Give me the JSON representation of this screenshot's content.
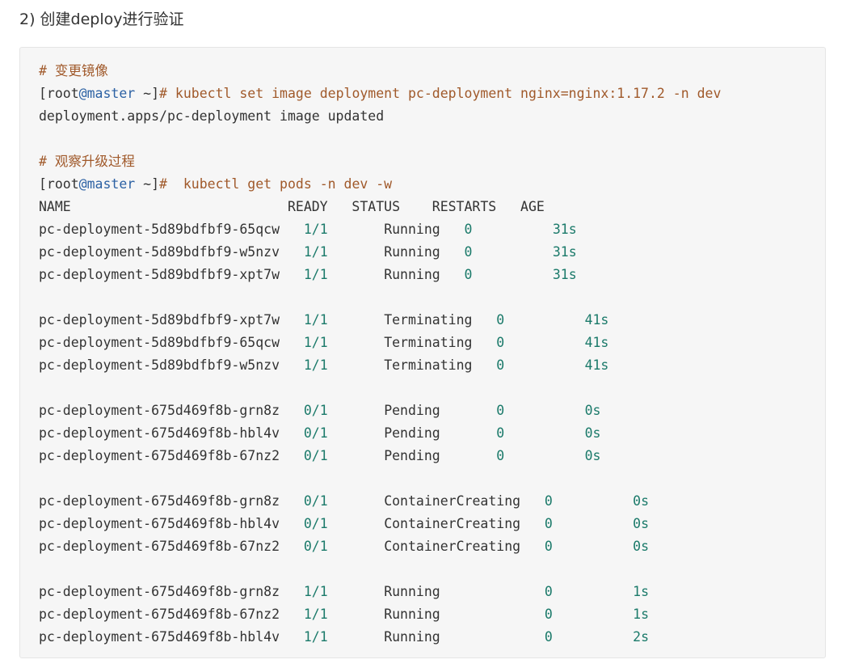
{
  "heading": "2) 创建deploy进行验证",
  "code": {
    "comment1": "# 变更镜像",
    "prompt1": {
      "bracket_open": "[root",
      "at_host": "@master",
      "rest": " ~]",
      "hash_cmd": "# kubectl set image deployment pc-deployment nginx=nginx:1.17.2 -n dev"
    },
    "output1": "deployment.apps/pc-deployment image updated",
    "comment2": "# 观察升级过程",
    "prompt2": {
      "bracket_open": "[root",
      "at_host": "@master",
      "rest": " ~]",
      "hash_cmd": "#  kubectl get pods -n dev -w"
    },
    "header": "NAME                           READY   STATUS    RESTARTS   AGE",
    "groups": [
      [
        {
          "name": "pc-deployment-5d89bdfbf9-65qcw",
          "ready": "1/1",
          "status": "Running",
          "restarts": "0",
          "age": "31s",
          "pad_ready": "   ",
          "pad_status": "     ",
          "pad_restarts": "   ",
          "pad_age": "          "
        },
        {
          "name": "pc-deployment-5d89bdfbf9-w5nzv",
          "ready": "1/1",
          "status": "Running",
          "restarts": "0",
          "age": "31s",
          "pad_ready": "   ",
          "pad_status": "     ",
          "pad_restarts": "   ",
          "pad_age": "          "
        },
        {
          "name": "pc-deployment-5d89bdfbf9-xpt7w",
          "ready": "1/1",
          "status": "Running",
          "restarts": "0",
          "age": "31s",
          "pad_ready": "   ",
          "pad_status": "     ",
          "pad_restarts": "   ",
          "pad_age": "          "
        }
      ],
      [
        {
          "name": "pc-deployment-5d89bdfbf9-xpt7w",
          "ready": "1/1",
          "status": "Terminating",
          "restarts": "0",
          "age": "41s",
          "pad_ready": "   ",
          "pad_status": "     ",
          "pad_restarts": "   ",
          "pad_age": "          "
        },
        {
          "name": "pc-deployment-5d89bdfbf9-65qcw",
          "ready": "1/1",
          "status": "Terminating",
          "restarts": "0",
          "age": "41s",
          "pad_ready": "   ",
          "pad_status": "     ",
          "pad_restarts": "   ",
          "pad_age": "          "
        },
        {
          "name": "pc-deployment-5d89bdfbf9-w5nzv",
          "ready": "1/1",
          "status": "Terminating",
          "restarts": "0",
          "age": "41s",
          "pad_ready": "   ",
          "pad_status": "     ",
          "pad_restarts": "   ",
          "pad_age": "          "
        }
      ],
      [
        {
          "name": "pc-deployment-675d469f8b-grn8z",
          "ready": "0/1",
          "status": "Pending",
          "restarts": "0",
          "age": "0s",
          "pad_ready": "   ",
          "pad_status": "     ",
          "pad_restarts": "       ",
          "pad_age": "          "
        },
        {
          "name": "pc-deployment-675d469f8b-hbl4v",
          "ready": "0/1",
          "status": "Pending",
          "restarts": "0",
          "age": "0s",
          "pad_ready": "   ",
          "pad_status": "     ",
          "pad_restarts": "       ",
          "pad_age": "          "
        },
        {
          "name": "pc-deployment-675d469f8b-67nz2",
          "ready": "0/1",
          "status": "Pending",
          "restarts": "0",
          "age": "0s",
          "pad_ready": "   ",
          "pad_status": "     ",
          "pad_restarts": "       ",
          "pad_age": "          "
        }
      ],
      [
        {
          "name": "pc-deployment-675d469f8b-grn8z",
          "ready": "0/1",
          "status": "ContainerCreating",
          "restarts": "0",
          "age": "0s",
          "pad_ready": "   ",
          "pad_status": "     ",
          "pad_restarts": "   ",
          "pad_age": "          "
        },
        {
          "name": "pc-deployment-675d469f8b-hbl4v",
          "ready": "0/1",
          "status": "ContainerCreating",
          "restarts": "0",
          "age": "0s",
          "pad_ready": "   ",
          "pad_status": "     ",
          "pad_restarts": "   ",
          "pad_age": "          "
        },
        {
          "name": "pc-deployment-675d469f8b-67nz2",
          "ready": "0/1",
          "status": "ContainerCreating",
          "restarts": "0",
          "age": "0s",
          "pad_ready": "   ",
          "pad_status": "     ",
          "pad_restarts": "   ",
          "pad_age": "          "
        }
      ],
      [
        {
          "name": "pc-deployment-675d469f8b-grn8z",
          "ready": "1/1",
          "status": "Running",
          "restarts": "0",
          "age": "1s",
          "pad_ready": "   ",
          "pad_status": "     ",
          "pad_restarts": "             ",
          "pad_age": "          "
        },
        {
          "name": "pc-deployment-675d469f8b-67nz2",
          "ready": "1/1",
          "status": "Running",
          "restarts": "0",
          "age": "1s",
          "pad_ready": "   ",
          "pad_status": "     ",
          "pad_restarts": "             ",
          "pad_age": "          "
        },
        {
          "name": "pc-deployment-675d469f8b-hbl4v",
          "ready": "1/1",
          "status": "Running",
          "restarts": "0",
          "age": "2s",
          "pad_ready": "   ",
          "pad_status": "     ",
          "pad_restarts": "             ",
          "pad_age": "          "
        }
      ]
    ]
  },
  "colors": {
    "comment": "#a0592a",
    "host": "#2d62a4",
    "number": "#1b7a6a",
    "background": "#f6f6f6"
  }
}
